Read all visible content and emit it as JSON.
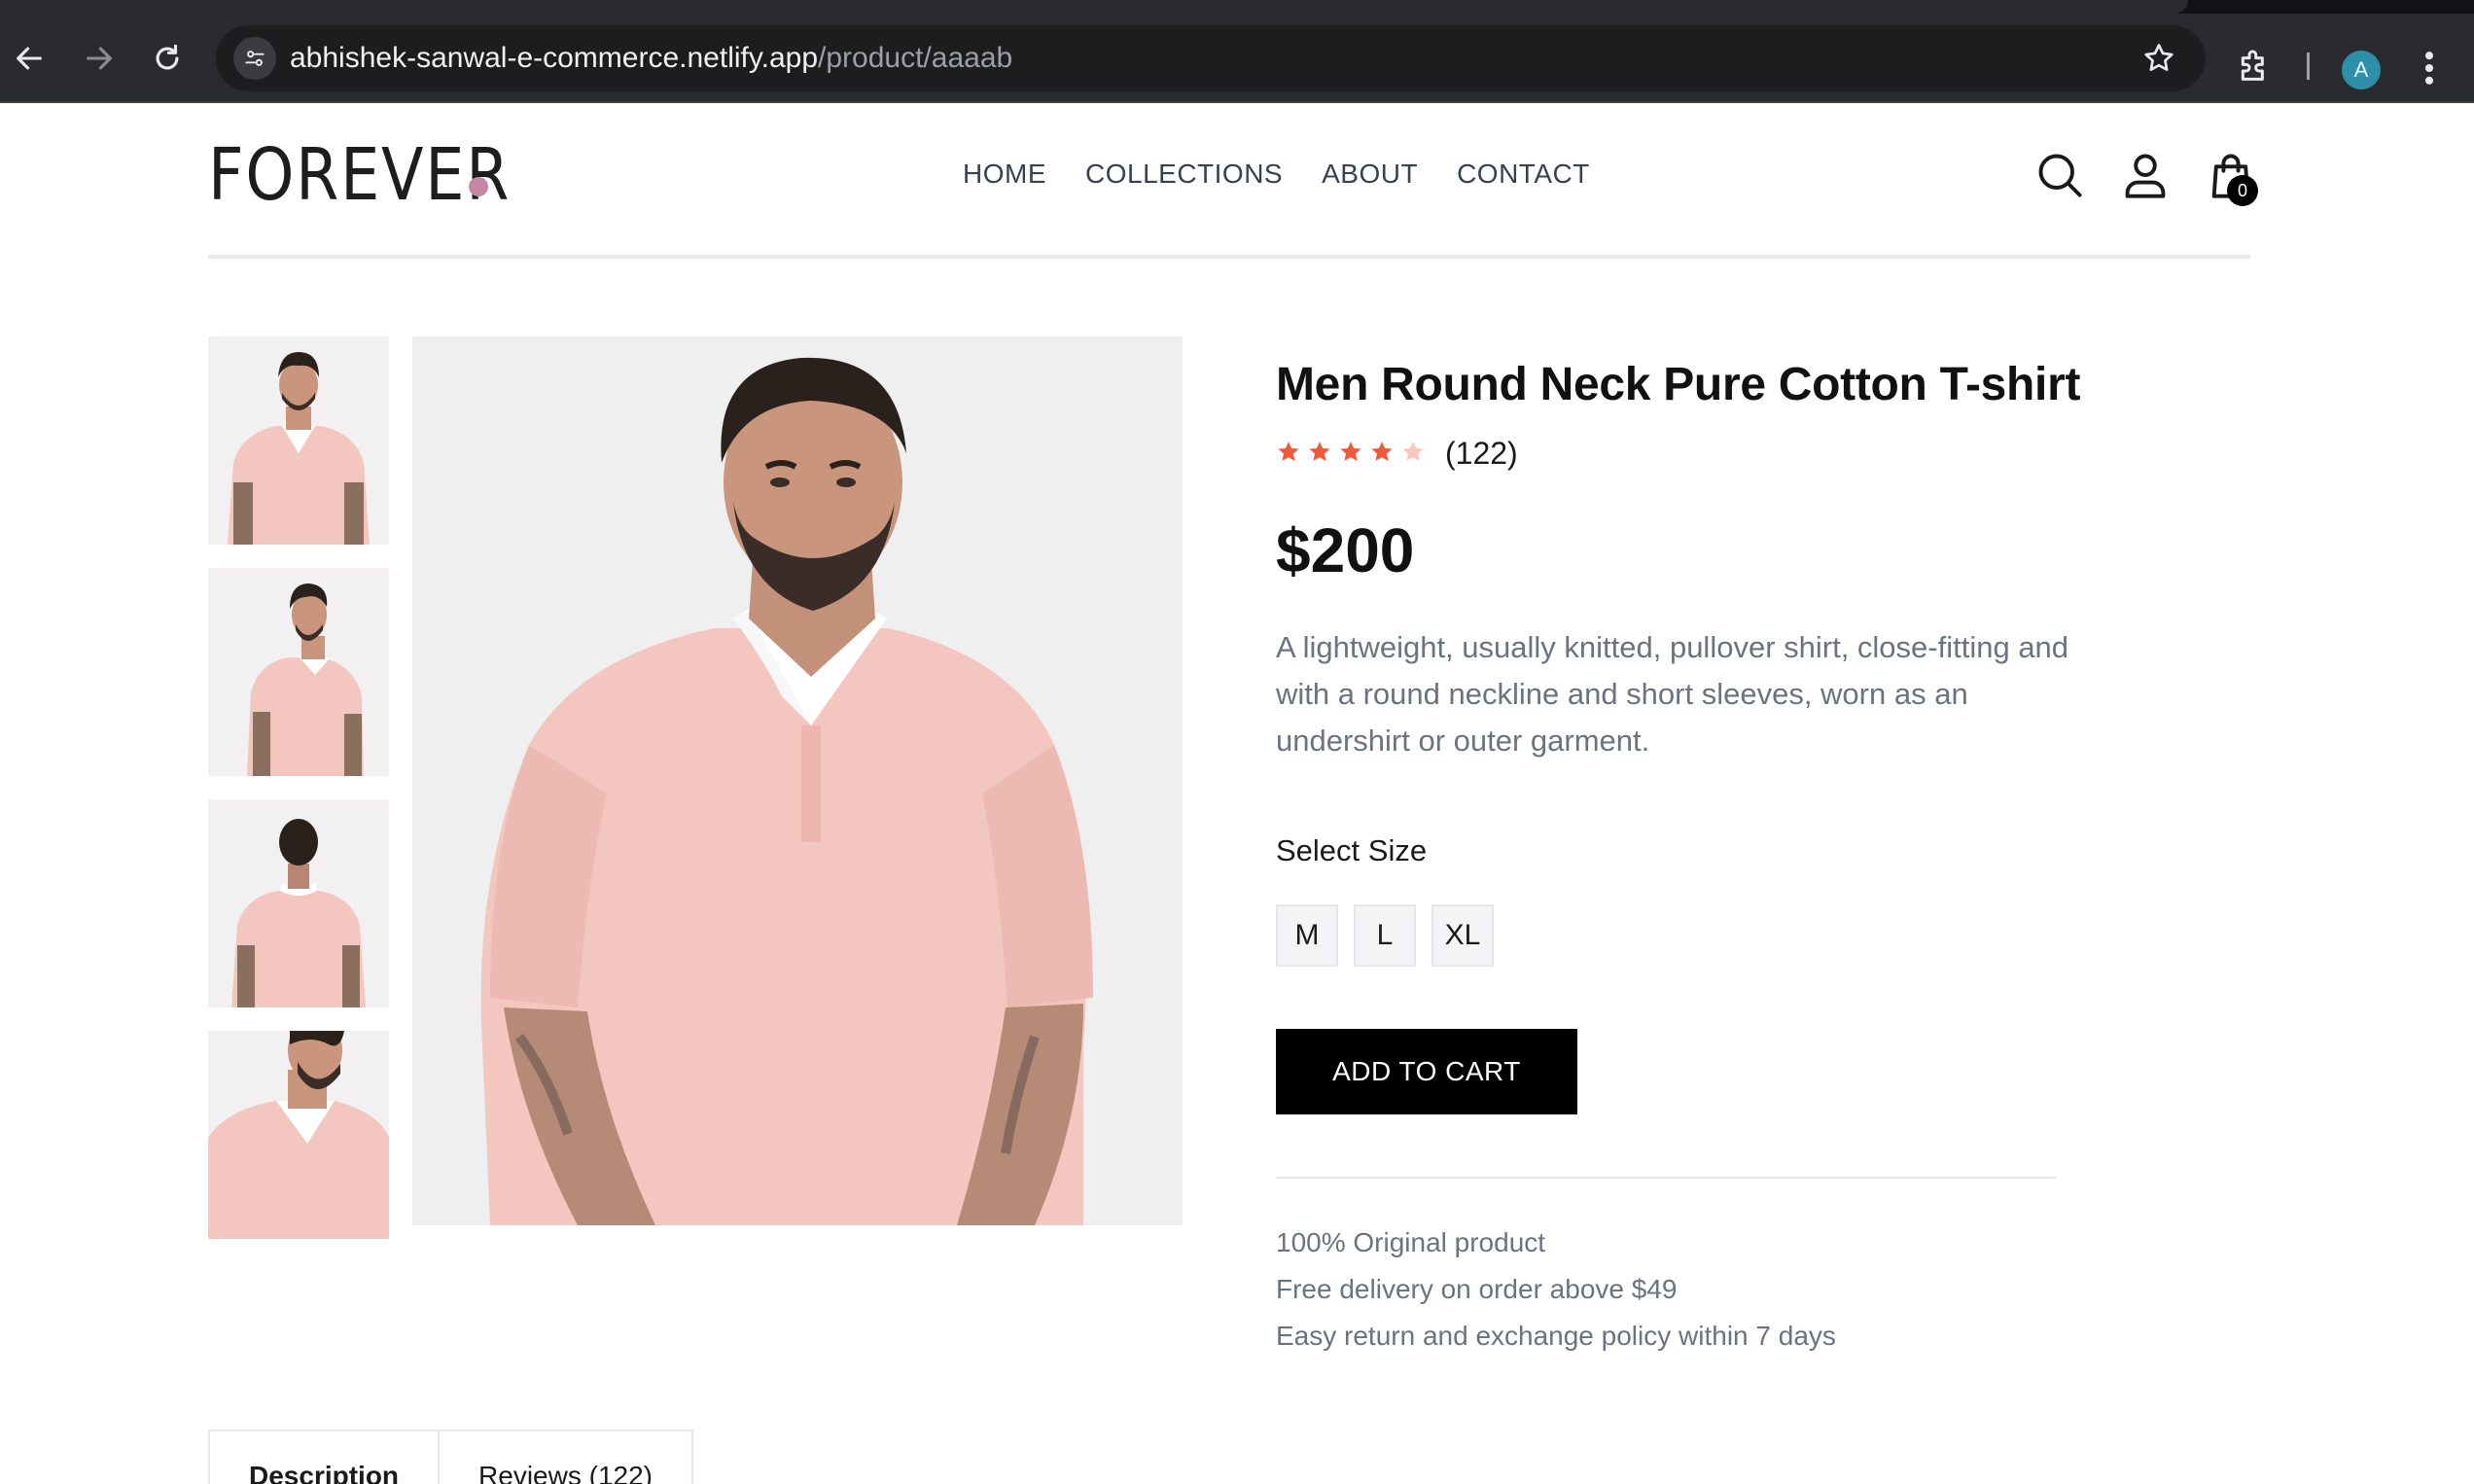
{
  "browser": {
    "url_host": "abhishek-sanwal-e-commerce.netlify.app",
    "url_path": "/product/aaaab",
    "profile_initial": "A",
    "icons": [
      "back-arrow-icon",
      "forward-arrow-icon",
      "reload-icon",
      "site-settings-icon",
      "bookmark-star-icon",
      "extensions-icon",
      "more-menu-icon"
    ]
  },
  "header": {
    "logo_text": "FOREVER",
    "logo_dot_color": "#c586a5",
    "nav": [
      "HOME",
      "COLLECTIONS",
      "ABOUT",
      "CONTACT"
    ],
    "cart_count": "0",
    "icons": [
      "search-icon",
      "profile-icon",
      "shopping-bag-icon"
    ]
  },
  "product": {
    "title": "Men Round Neck Pure Cotton T-shirt",
    "rating_filled": 4,
    "rating_max": 5,
    "rating_count": "(122)",
    "price": "$200",
    "description": "A lightweight, usually knitted, pullover shirt, close-fitting and with a round neckline and short sleeves, worn as an undershirt or outer garment.",
    "size_label": "Select Size",
    "sizes": [
      "M",
      "L",
      "XL"
    ],
    "add_to_cart": "ADD TO CART",
    "perks": [
      "100% Original product",
      "Free delivery on order above $49",
      "Easy return and exchange policy within 7 days"
    ],
    "shirt_color": "#f3c6c0",
    "star_color": "#f05a3c"
  },
  "tabs": [
    "Description",
    "Reviews (122)"
  ]
}
